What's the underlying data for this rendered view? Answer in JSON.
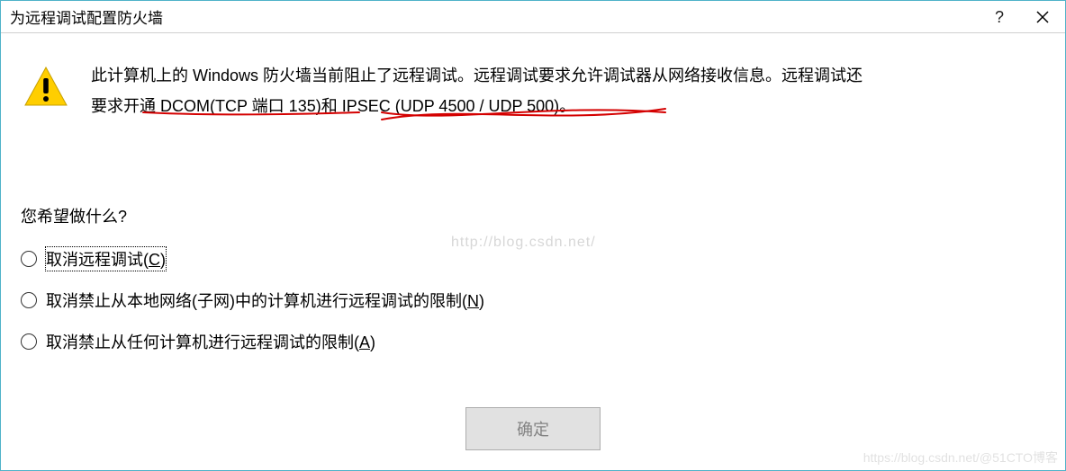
{
  "titlebar": {
    "title": "为远程调试配置防火墙",
    "help_label": "?",
    "close_label": "Close"
  },
  "message": {
    "line1_a": "此计算机上的 Windows 防火墙当前阻止了远程调试。远程调试要求允许调试器从网络接收信息。远程调试还",
    "line2_a": "要求开通 ",
    "line2_b": "DCOM(TCP 端口 135)",
    "line2_c": "和 ",
    "line2_d": "IPSEC (UDP 4500 / UDP 500)",
    "line2_e": "。"
  },
  "prompt": "您希望做什么?",
  "options": [
    {
      "pre": "取消远程调试(",
      "accel": "C",
      "post": ")",
      "focused": true
    },
    {
      "pre": "取消禁止从本地网络(子网)中的计算机进行远程调试的限制(",
      "accel": "N",
      "post": ")",
      "focused": false
    },
    {
      "pre": "取消禁止从任何计算机进行远程调试的限制(",
      "accel": "A",
      "post": ")",
      "focused": false
    }
  ],
  "buttons": {
    "ok": "确定"
  },
  "watermarks": {
    "center": "http://blog.csdn.net/",
    "bottom_right": "https://blog.csdn.net/@51CTO博客"
  }
}
